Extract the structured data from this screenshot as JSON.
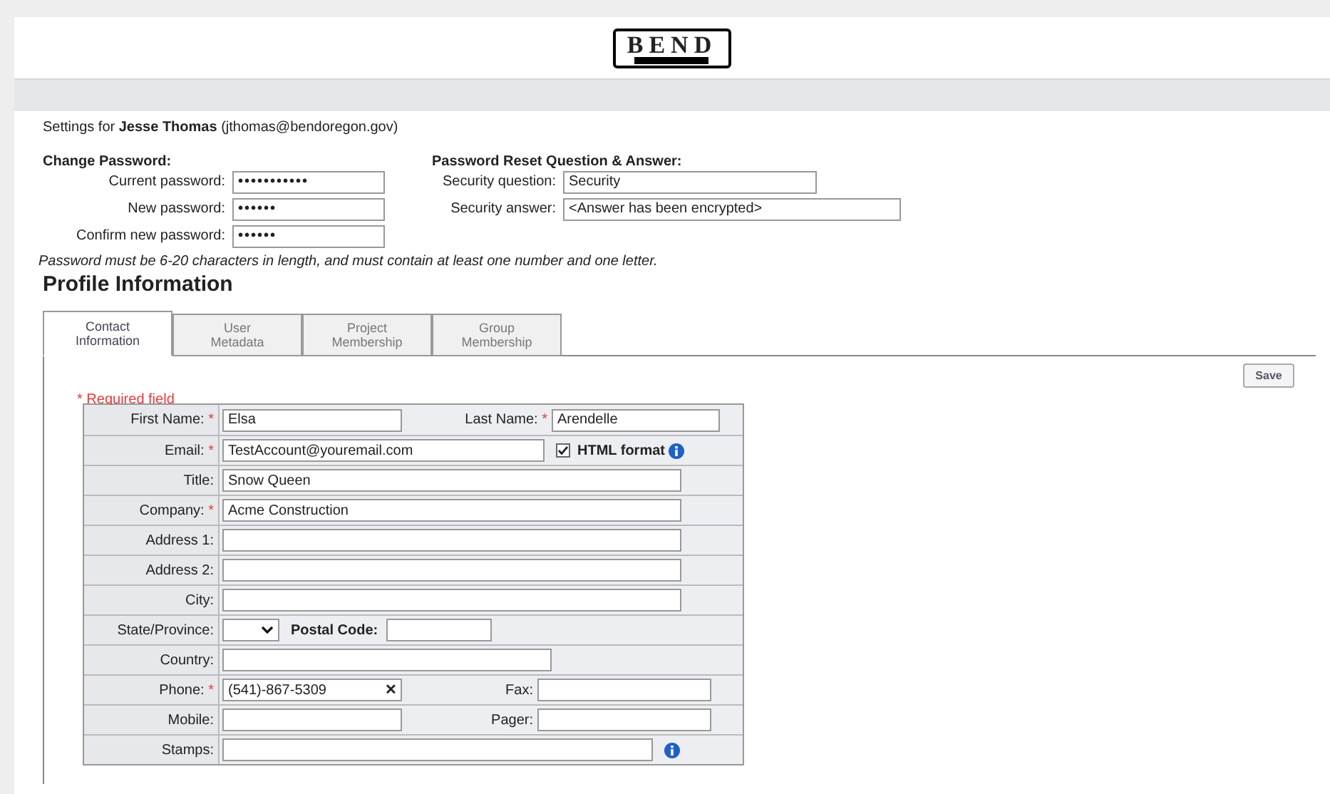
{
  "logo": {
    "text": "BEND"
  },
  "settings": {
    "prefix": "Settings for",
    "name": "Jesse Thomas",
    "email": "(jthomas@bendoregon.gov)"
  },
  "change_password": {
    "title": "Change Password:",
    "fields": [
      {
        "label": "Current password:",
        "value": "•••••••••••"
      },
      {
        "label": "New password:",
        "value": "••••••"
      },
      {
        "label": "Confirm new password:",
        "value": "••••••"
      }
    ]
  },
  "reset": {
    "title": "Password Reset Question & Answer:",
    "fields": [
      {
        "label": "Security question:",
        "value": "Security"
      },
      {
        "label": "Security answer:",
        "value": "<Answer has been encrypted>"
      }
    ]
  },
  "password_hint": "Password must be 6-20 characters in length, and must contain at least one number and one letter.",
  "profile_title": "Profile Information",
  "tabs": [
    {
      "line1": "Contact",
      "line2": "Information",
      "selected": true
    },
    {
      "line1": "User",
      "line2": "Metadata",
      "selected": false
    },
    {
      "line1": "Project",
      "line2": "Membership",
      "selected": false
    },
    {
      "line1": "Group",
      "line2": "Membership",
      "selected": false
    }
  ],
  "save_button": "Save",
  "required_note": "* Required field",
  "rows": [
    {
      "kind": "pair",
      "label": "First Name:",
      "mark": "*",
      "value": "Elsa",
      "label2": "Last Name:",
      "mark2": "*",
      "value2": "Arendelle"
    },
    {
      "kind": "email",
      "label": "Email:",
      "mark": "*",
      "value": "TestAccount@youremail.com",
      "checkbox_label": "HTML format",
      "checked": true
    },
    {
      "kind": "long",
      "label": "Title:",
      "value": "Snow Queen"
    },
    {
      "kind": "long",
      "label": "Company:",
      "mark": "*",
      "value": "Acme Construction"
    },
    {
      "kind": "long",
      "label": "Address 1:"
    },
    {
      "kind": "long",
      "label": "Address 2:"
    },
    {
      "kind": "long",
      "label": "City:"
    },
    {
      "kind": "state",
      "label": "State/Province:",
      "label2": "Postal Code:"
    },
    {
      "kind": "medium",
      "label": "Country:"
    },
    {
      "kind": "phone",
      "label": "Phone:",
      "mark": "*",
      "value": "(541)-867-5309",
      "clear": "✕",
      "label2": "Fax:"
    },
    {
      "kind": "pair2",
      "label": "Mobile:",
      "label2": "Pager:"
    },
    {
      "kind": "stamps",
      "label": "Stamps:"
    }
  ]
}
